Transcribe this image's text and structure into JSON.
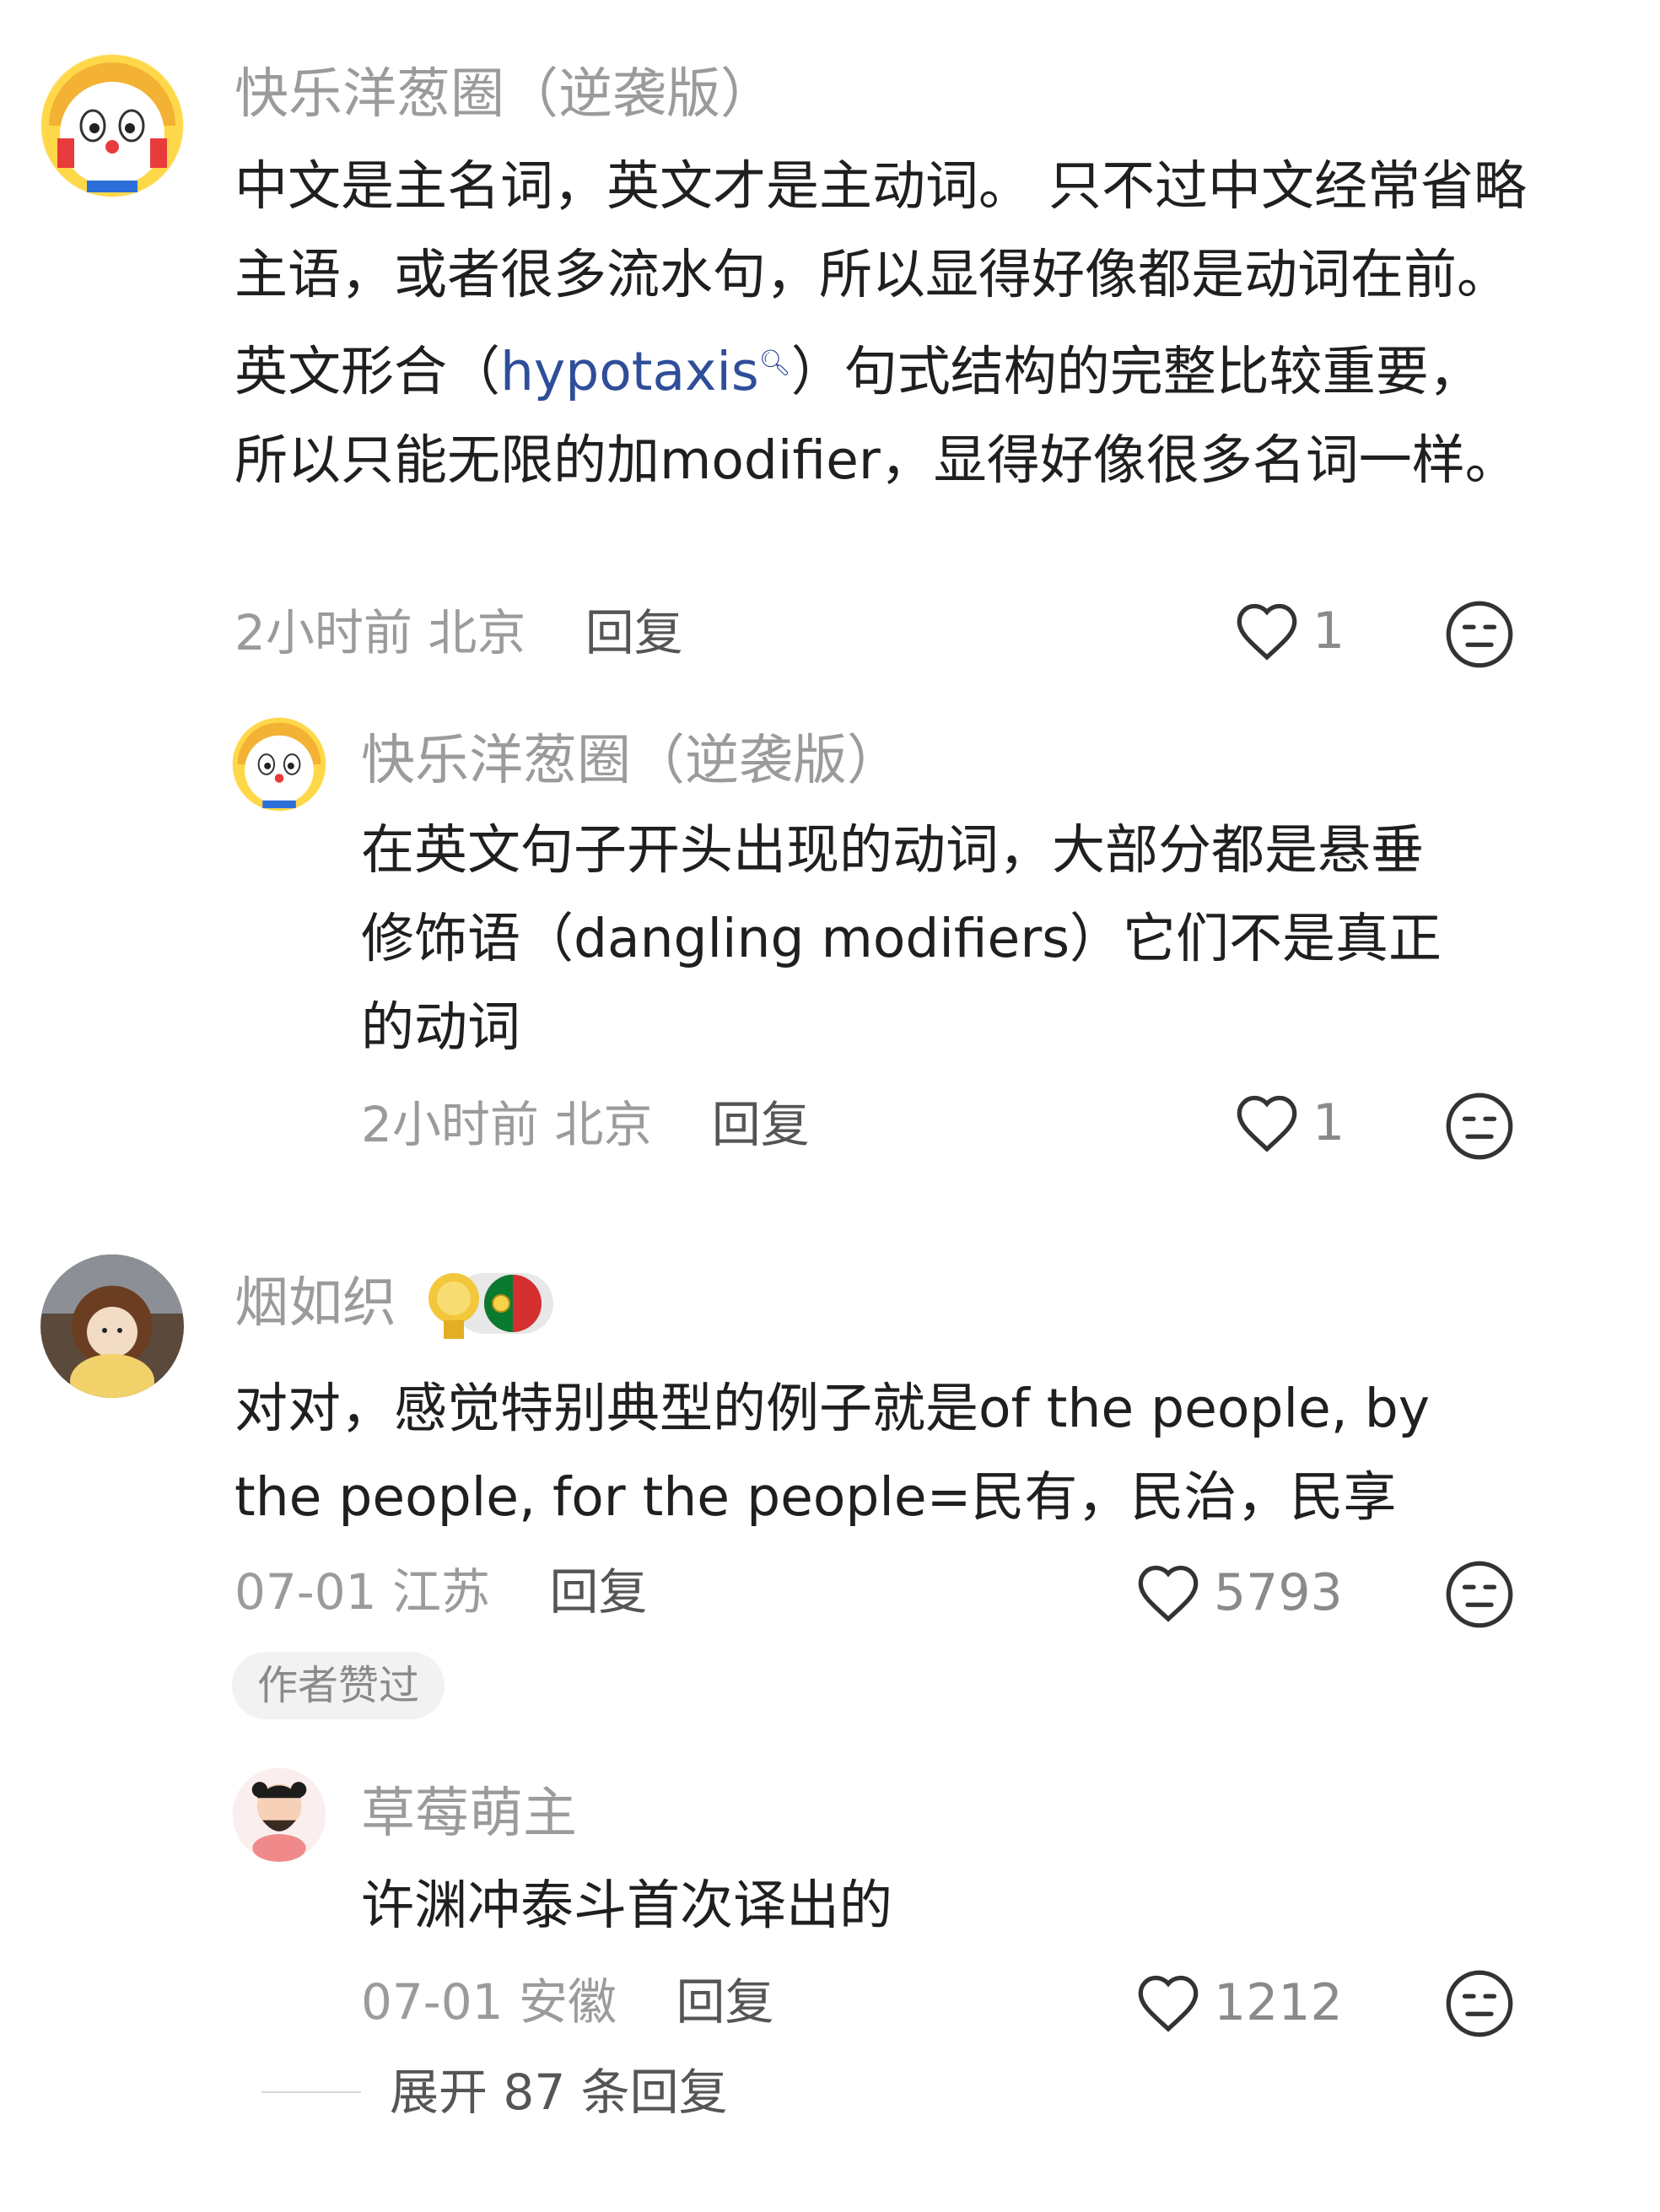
{
  "comments": [
    {
      "user": "快乐洋葱圈（逆袭版）",
      "text_pre": "中文是主名词，英文才是主动词。 只不过中文经常省略主语，或者很多流水句，所以显得好像都是动词在前。英文形合（",
      "link": "hypotaxis",
      "text_post": "）句式结构的完整比较重要，所以只能无限的加modifier，显得好像很多名词一样。",
      "time": "2小时前",
      "location": "北京",
      "reply": "回复",
      "likes": "1"
    },
    {
      "user": "快乐洋葱圈（逆袭版）",
      "text": "在英文句子开头出现的动词，大部分都是悬垂修饰语（dangling modifiers）它们不是真正的动词",
      "time": "2小时前",
      "location": "北京",
      "reply": "回复",
      "likes": "1"
    },
    {
      "user": "烟如织",
      "text": "对对，感觉特别典型的例子就是of the people, by the people, for the people=民有，民治，民享",
      "time": "07-01",
      "location": "江苏",
      "reply": "回复",
      "likes": "5793",
      "badge": "作者赞过"
    },
    {
      "user": "草莓萌主",
      "text": "许渊冲泰斗首次译出的",
      "time": "07-01",
      "location": "安徽",
      "reply": "回复",
      "likes": "1212"
    }
  ],
  "expand_replies": "展开 87 条回复",
  "icons": {
    "like": "heart-outline-icon",
    "dislike": "neutral-face-icon",
    "search": "search-icon",
    "badge": "medal-portugal-flag-icon"
  },
  "colors": {
    "name_gray": "#9b9b9b",
    "link_blue": "#2f4e9a",
    "badge_bg": "#f2f2f2"
  }
}
